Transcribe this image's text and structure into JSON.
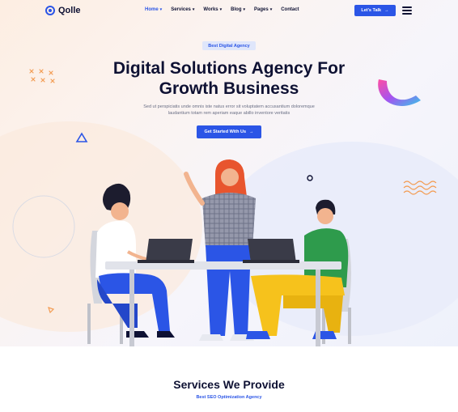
{
  "brand": {
    "name": "Qolle"
  },
  "nav": [
    {
      "label": "Home",
      "caret": "▾",
      "active": true
    },
    {
      "label": "Services",
      "caret": "▾"
    },
    {
      "label": "Works",
      "caret": "▾"
    },
    {
      "label": "Blog",
      "caret": "▾"
    },
    {
      "label": "Pages",
      "caret": "▾"
    },
    {
      "label": "Contact",
      "caret": ""
    }
  ],
  "header": {
    "cta_label": "Let's Talk",
    "cta_arrow": "→",
    "menu_icon": "hamburger-icon"
  },
  "hero": {
    "badge": "Best Digital Agency",
    "title_line1": "Digital Solutions Agency For",
    "title_line2": "Growth Business",
    "desc_line1": "Sed ut perspiciatis unde omnis iste natus error sit voluptatem accusantium doloremque",
    "desc_line2": "laudantium totam rem aperiam eaque abillo inventore veritatis",
    "cta_label": "Get Started With Us",
    "cta_arrow": "→"
  },
  "services": {
    "title": "Services We Provide",
    "subtitle": "Best SEO Optimization Agency"
  },
  "colors": {
    "primary": "#2b55e6",
    "dark": "#0e1133",
    "accent_orange": "#f39c53",
    "shirt_green": "#2e9b4c",
    "pants_yellow": "#f6c21c",
    "hair_red": "#e8552e"
  }
}
